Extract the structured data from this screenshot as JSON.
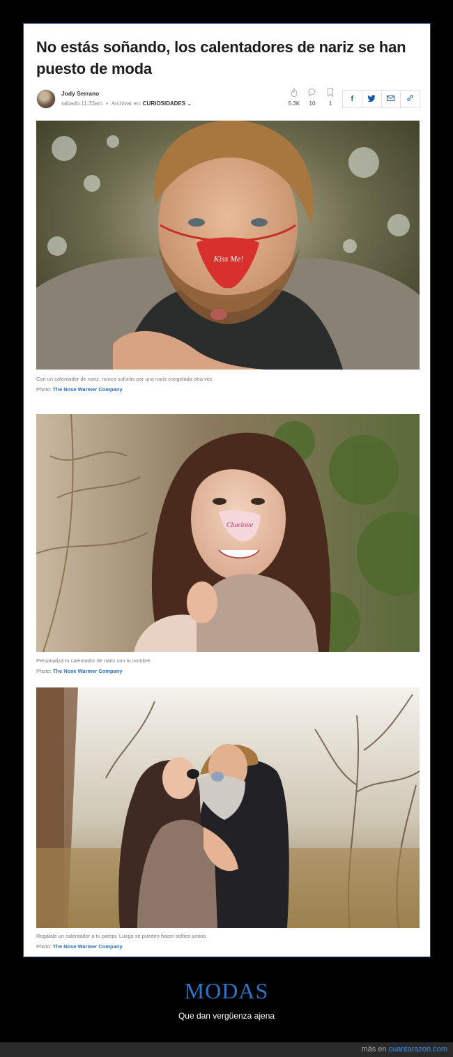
{
  "article": {
    "title": "No estás soñando, los calentadores de nariz se han puesto de moda",
    "author": "Jody Serrano",
    "date": "sábado 11:33am",
    "separator": "•",
    "archive_label": "Archivar en:",
    "category": "CURIOSIDADES",
    "stats": [
      {
        "icon": "flame-icon",
        "value": "5.3K"
      },
      {
        "icon": "comment-icon",
        "value": "10"
      },
      {
        "icon": "bookmark-icon",
        "value": "1"
      }
    ],
    "share": [
      "f",
      "tw",
      "mail",
      "link"
    ]
  },
  "photos": [
    {
      "caption": "Con un calentador de nariz, nunca sufrirás por una nariz congelada otra vez.",
      "credit_label": "Photo:",
      "credit_source": "The Nose Warmer Company",
      "nose_text": "Kiss Me!"
    },
    {
      "caption": "Personaliza tu calentador de nariz con tu nombre.",
      "credit_label": "Photo:",
      "credit_source": "The Nose Warmer Company",
      "nose_text": "Charlotte"
    },
    {
      "caption": "Regálale un calentador a tu pareja. Luego se pueden hacer selfies juntos.",
      "credit_label": "Photo:",
      "credit_source": "The Nose Warmer Company"
    }
  ],
  "footer": {
    "title": "MODAS",
    "subtitle": "Que dan vergüenza ajena",
    "more_label": "más en",
    "site": "cuantarazon.com"
  }
}
